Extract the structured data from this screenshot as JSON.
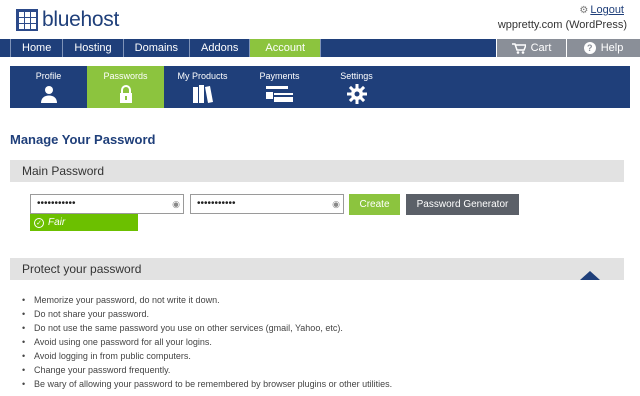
{
  "header": {
    "logo_text": "bluehost",
    "logout_label": "Logout",
    "account_name": "wppretty.com (WordPress)"
  },
  "topnav": {
    "items": [
      {
        "label": "Home"
      },
      {
        "label": "Hosting"
      },
      {
        "label": "Domains"
      },
      {
        "label": "Addons"
      },
      {
        "label": "Account",
        "active": true
      }
    ],
    "cart_label": "Cart",
    "help_label": "Help"
  },
  "subnav": {
    "tabs": [
      {
        "label": "Profile",
        "icon": "user-icon"
      },
      {
        "label": "Passwords",
        "icon": "lock-icon",
        "active": true
      },
      {
        "label": "My Products",
        "icon": "books-icon"
      },
      {
        "label": "Payments",
        "icon": "credit-card-icon"
      },
      {
        "label": "Settings",
        "icon": "gear-icon"
      }
    ]
  },
  "main": {
    "page_title": "Manage Your Password",
    "section_main_title": "Main Password",
    "password_value": "•••••••••••",
    "confirm_value": "•••••••••••",
    "strength_label": "Fair",
    "create_label": "Create",
    "generator_label": "Password Generator",
    "section_protect_title": "Protect your password",
    "tips": [
      "Memorize your password, do not write it down.",
      "Do not share your password.",
      "Do not use the same password you use on other services (gmail, Yahoo, etc).",
      "Avoid using one password for all your logins.",
      "Avoid logging in from public computers.",
      "Change your password frequently.",
      "Be wary of allowing your password to be remembered by browser plugins or other utilities."
    ]
  },
  "colors": {
    "brand_blue": "#1f3f7a",
    "accent_green": "#8cc43e",
    "strength_green": "#6cc000",
    "gray_button": "#5b6068"
  }
}
